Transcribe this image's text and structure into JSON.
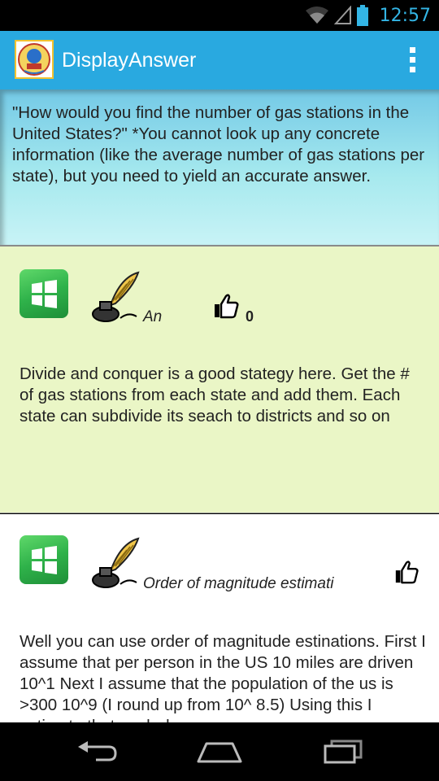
{
  "status_bar": {
    "time": "12:57",
    "icons": [
      "wifi-icon",
      "cell-signal-icon",
      "battery-icon"
    ],
    "accent_color": "#33b5e5"
  },
  "action_bar": {
    "title": "DisplayAnswer",
    "background_color": "#29a9e0",
    "icons": [
      "app-logo-icon",
      "overflow-menu-icon"
    ]
  },
  "question": {
    "text": "\"How would you find the number of gas stations in the United States?\" *You cannot look up any concrete information (like the average number of gas stations per state), but you need to yield an accurate answer."
  },
  "answers": [
    {
      "author": "An",
      "like_count": "0",
      "text": "Divide and conquer is a good stategy here. Get the # of gas stations from each state and add them. Each state can subdivide its seach to districts and so on",
      "background_color": "#eaf6c6",
      "icons": [
        "windows-icon",
        "quill-inkwell-icon",
        "thumbs-up-icon"
      ]
    },
    {
      "author": "Order of magnitude estimati",
      "text": "Well you can use order of magnitude estinations. First I assume that per person in the US 10 miles are driven 10^1 Next I assume that the population of the us is >300 10^9 (I round up from 10^ 8.5) Using this I estimate that each day",
      "background_color": "#ffffff",
      "icons": [
        "windows-icon",
        "quill-inkwell-icon",
        "thumbs-up-icon"
      ]
    }
  ],
  "nav_bar": {
    "icons": [
      "back-icon",
      "home-icon",
      "recent-apps-icon"
    ]
  }
}
